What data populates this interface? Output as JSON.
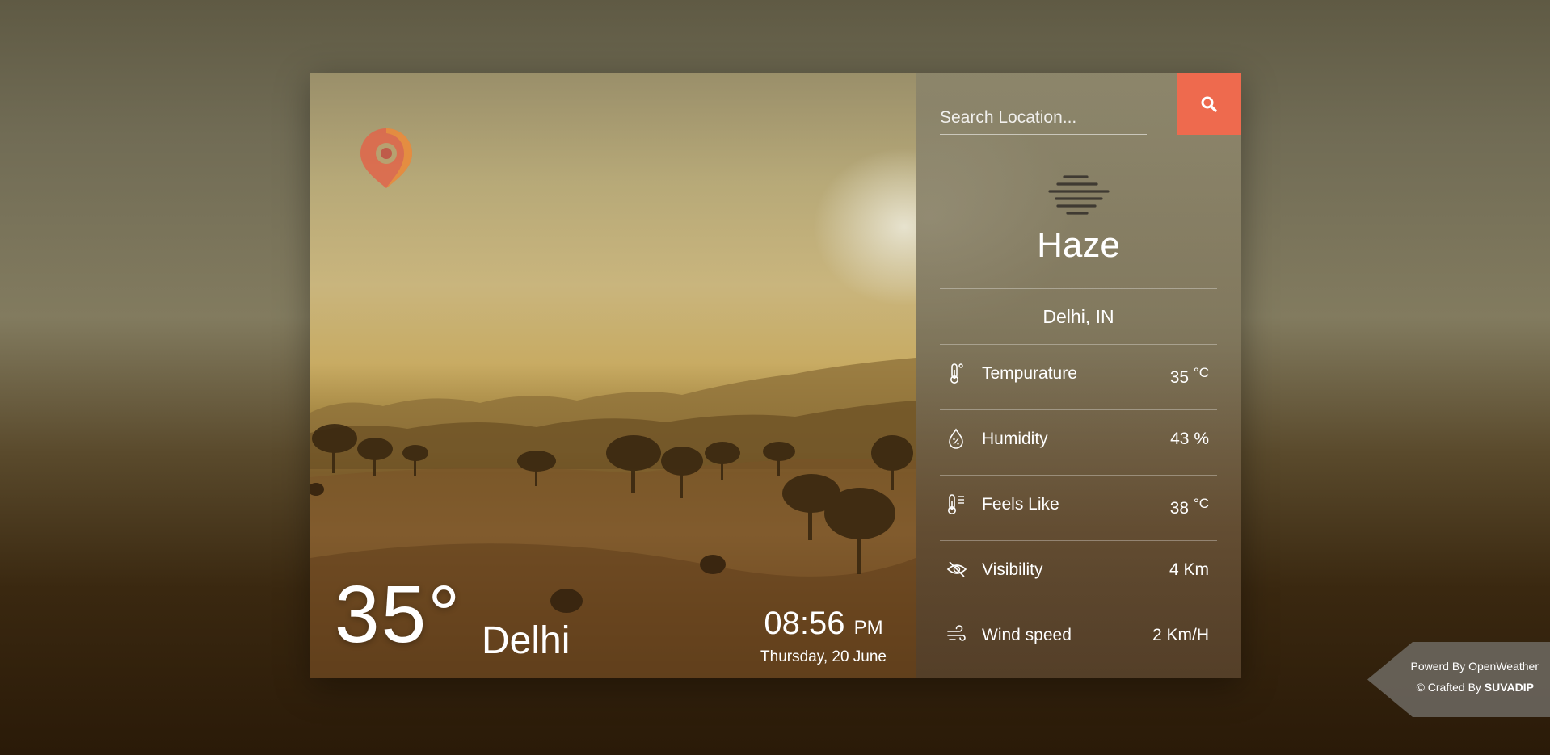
{
  "app": {
    "accent_color": "#ee6a4e"
  },
  "hero": {
    "temperature": "35°",
    "city": "Delhi",
    "time": "08:56",
    "ampm": "PM",
    "date": "Thursday, 20 June"
  },
  "search": {
    "placeholder": "Search Location...",
    "button_icon": "search-icon"
  },
  "weather": {
    "condition": "Haze",
    "condition_icon": "haze-icon",
    "location": "Delhi,  IN"
  },
  "details": [
    {
      "label": "Tempurature",
      "value": "35",
      "unit": "°C",
      "icon": "thermometer-icon"
    },
    {
      "label": "Humidity",
      "value": "43 %",
      "unit": "",
      "icon": "humidity-drop-icon"
    },
    {
      "label": "Feels Like",
      "value": "38",
      "unit": "°C",
      "icon": "feels-like-thermometer-icon"
    },
    {
      "label": "Visibility",
      "value": "4 Km",
      "unit": "",
      "icon": "visibility-off-icon"
    },
    {
      "label": "Wind speed",
      "value": "2 Km/H",
      "unit": "",
      "icon": "wind-icon"
    }
  ],
  "footer": {
    "powered_by": "Powerd By OpenWeather",
    "crafted_prefix": "© Crafted By ",
    "crafted_name": "SUVADIP"
  }
}
